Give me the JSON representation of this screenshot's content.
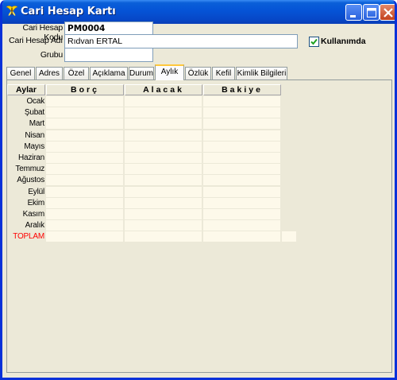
{
  "window": {
    "title": "Cari Hesap Kartı"
  },
  "form": {
    "code_label": "Cari Hesap Kodu",
    "code_value": "PM0004",
    "name_label": "Cari Hesap Adı",
    "name_value": "Rıdvan ERTAL",
    "group_label": "Grubu",
    "group_value": "",
    "active_label": "Kullanımda",
    "active_checked": true
  },
  "tabs": [
    "Genel",
    "Adres",
    "Özel",
    "Açıklama",
    "Durum",
    "Aylık",
    "Özlük",
    "Kefil",
    "Kimlik Bilgileri"
  ],
  "active_tab": "Aylık",
  "grid": {
    "headers": [
      "Aylar",
      "Borç",
      "Alacak",
      "Bakiye"
    ],
    "months": [
      "Ocak",
      "Şubat",
      "Mart",
      "Nisan",
      "Mayıs",
      "Haziran",
      "Temmuz",
      "Ağustos",
      "Eylül",
      "Ekim",
      "Kasım",
      "Aralık"
    ],
    "total_label": "TOPLAM"
  },
  "colors": {
    "titlebar": "#0553d6",
    "total_label": "#ff0000",
    "cell_bg": "#fdf9ea"
  }
}
